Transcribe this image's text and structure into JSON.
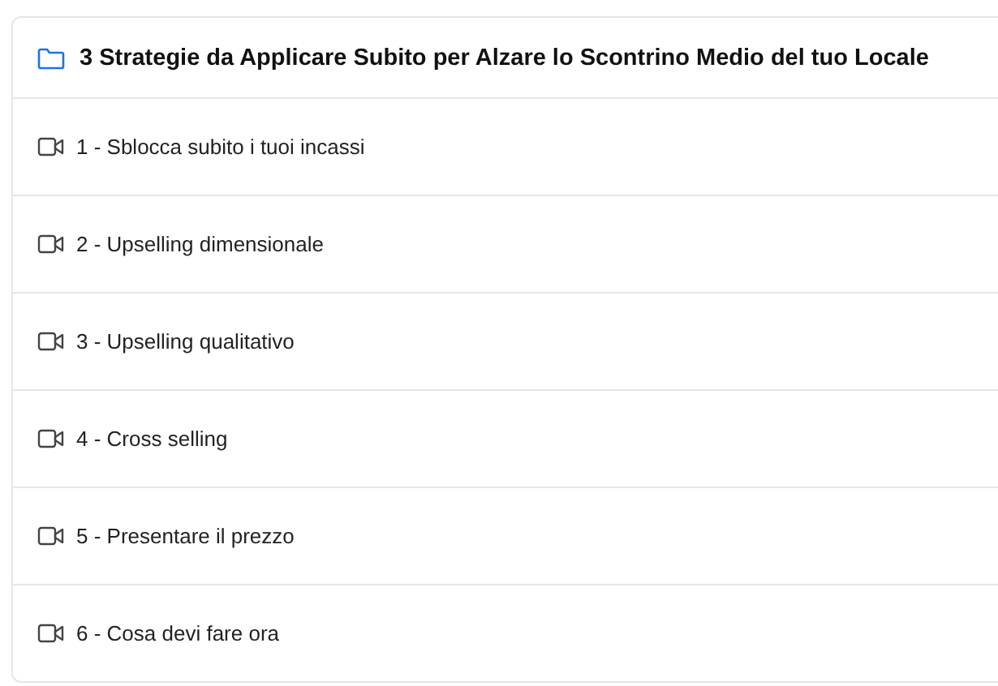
{
  "section": {
    "title": "3 Strategie da Applicare Subito per Alzare lo Scontrino Medio del tuo Locale"
  },
  "lessons": [
    {
      "label": "1 - Sblocca subito i tuoi incassi"
    },
    {
      "label": "2 - Upselling dimensionale"
    },
    {
      "label": "3 - Upselling qualitativo"
    },
    {
      "label": "4 - Cross selling"
    },
    {
      "label": "5 - Presentare il prezzo"
    },
    {
      "label": "6 - Cosa devi fare ora"
    }
  ]
}
